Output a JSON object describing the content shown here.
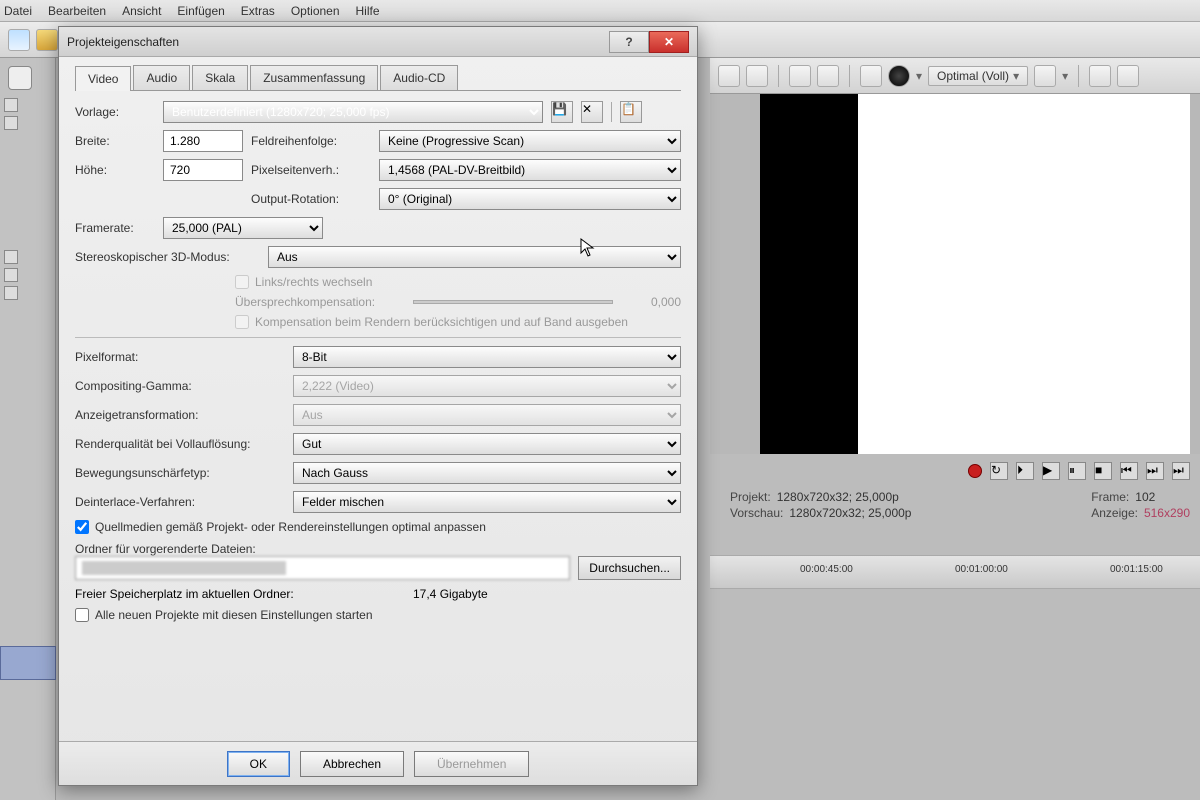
{
  "menubar": [
    "Datei",
    "Bearbeiten",
    "Ansicht",
    "Einfügen",
    "Extras",
    "Optionen",
    "Hilfe"
  ],
  "dialog": {
    "title": "Projekteigenschaften",
    "tabs": [
      "Video",
      "Audio",
      "Skala",
      "Zusammenfassung",
      "Audio-CD"
    ],
    "active_tab": 0,
    "labels": {
      "vorlage": "Vorlage:",
      "breite": "Breite:",
      "hoehe": "Höhe:",
      "feldreihenfolge": "Feldreihenfolge:",
      "pixelseitenverh": "Pixelseitenverh.:",
      "output_rotation": "Output-Rotation:",
      "framerate": "Framerate:",
      "stereo": "Stereoskopischer 3D-Modus:",
      "links_rechts": "Links/rechts wechseln",
      "uebersprech": "Übersprechkompensation:",
      "uebersprech_val": "0,000",
      "kompensation": "Kompensation beim Rendern berücksichtigen und auf Band ausgeben",
      "pixelformat": "Pixelformat:",
      "gamma": "Compositing-Gamma:",
      "anzeige": "Anzeigetransformation:",
      "renderqual": "Renderqualität bei Vollauflösung:",
      "bewegung": "Bewegungsunschärfetyp:",
      "deinterlace": "Deinterlace-Verfahren:",
      "quellmedien": "Quellmedien gemäß Projekt- oder Rendereinstellungen optimal anpassen",
      "ordner": "Ordner für vorgerenderte Dateien:",
      "durchsuchen": "Durchsuchen...",
      "freier": "Freier Speicherplatz im aktuellen Ordner:",
      "freier_val": "17,4 Gigabyte",
      "alle_neuen": "Alle neuen Projekte mit diesen Einstellungen starten"
    },
    "values": {
      "vorlage": "Benutzerdefiniert (1280x720; 25,000 fps)",
      "breite": "1.280",
      "hoehe": "720",
      "feldreihenfolge": "Keine (Progressive Scan)",
      "pixelseitenverh": "1,4568 (PAL-DV-Breitbild)",
      "output_rotation": "0° (Original)",
      "framerate": "25,000 (PAL)",
      "stereo": "Aus",
      "pixelformat": "8-Bit",
      "gamma": "2,222 (Video)",
      "anzeige": "Aus",
      "renderqual": "Gut",
      "bewegung": "Nach Gauss",
      "deinterlace": "Felder mischen"
    },
    "buttons": {
      "ok": "OK",
      "cancel": "Abbrechen",
      "apply": "Übernehmen"
    }
  },
  "preview": {
    "quality": "Optimal (Voll)",
    "info": {
      "projekt_lbl": "Projekt:",
      "projekt_val": "1280x720x32; 25,000p",
      "vorschau_lbl": "Vorschau:",
      "vorschau_val": "1280x720x32; 25,000p",
      "frame_lbl": "Frame:",
      "frame_val": "102",
      "anzeige_lbl": "Anzeige:",
      "anzeige_val": "516x290"
    }
  },
  "timeline": {
    "ticks": [
      "00:00:45:00",
      "00:01:00:00",
      "00:01:15:00"
    ]
  }
}
